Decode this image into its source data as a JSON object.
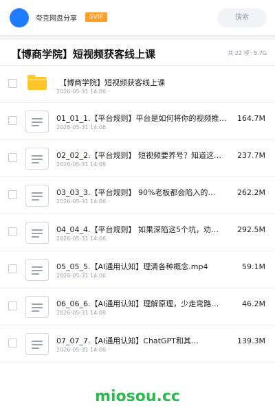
{
  "header": {
    "username": "夸克网盘分享",
    "badge": "SVIP",
    "search_label": "搜索"
  },
  "share": {
    "title": "【博商学院】短视频获客线上课",
    "count": "共 22 项",
    "size": "5.7G"
  },
  "items": [
    {
      "type": "folder",
      "name": "【博商学院】短视频获客线上课",
      "date": "2026-05-31 14:06",
      "size": ""
    },
    {
      "type": "file",
      "name": "01_01_1.【平台规则】平台是如何将你的视频推…",
      "date": "2026-05-31 14:06",
      "size": "164.7M"
    },
    {
      "type": "file",
      "name": "02_02_2.【平台规则】 短视频要养号？知道这…",
      "date": "2026-05-31 14:06",
      "size": "237.7M"
    },
    {
      "type": "file",
      "name": "03_03_3.【平台规则】 90%老板都会陷入的…",
      "date": "2026-05-31 14:06",
      "size": "262.2M"
    },
    {
      "type": "file",
      "name": "04_04_4.【平台规则】 如果深陷这5个坑，劝…",
      "date": "2026-05-31 14:06",
      "size": "292.5M"
    },
    {
      "type": "file",
      "name": "05_05_5.【AI通用认知】理清各种概念.mp4",
      "date": "2026-05-31 14:06",
      "size": "59.1M"
    },
    {
      "type": "file",
      "name": "06_06_6.【AI通用认知】理解原理，少走弯路…",
      "date": "2026-05-31 14:06",
      "size": "46.2M"
    },
    {
      "type": "file",
      "name": "07_07_7.【AI通用认知】ChatGPT和其…",
      "date": "2026-05-31 14:06",
      "size": "139.3M"
    }
  ],
  "watermark": "miosou.cc",
  "colors": {
    "avatar": "#1f7bff",
    "badge": "#ff9f2e",
    "watermark": "#2eb84f",
    "folder": "#ffc629"
  }
}
